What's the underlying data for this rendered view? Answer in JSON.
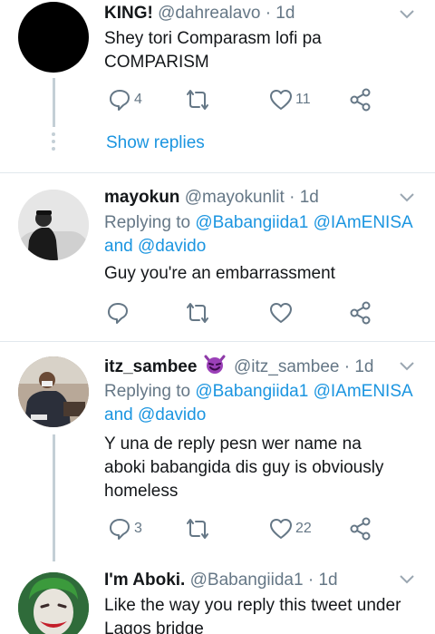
{
  "tweets": [
    {
      "name": "KING!",
      "handle": "@dahrealavo",
      "time": "· 1d",
      "text": "Shey  tori Comparasm lofi pa COMPARISM",
      "reply_count": "4",
      "retweet_count": "",
      "like_count": "11",
      "show_replies": "Show replies"
    },
    {
      "name": "mayokun",
      "handle": "@mayokunlit",
      "time": "· 1d",
      "replying_prefix": "Replying to",
      "mentions": [
        "@Babangiida1",
        "@IAmENISA"
      ],
      "and_word": "and",
      "mention_last": "@davido",
      "text": "Guy you're an embarrassment"
    },
    {
      "name": "itz_sambee",
      "emoji": "smiling-devil-emoji",
      "handle": "@itz_sambee",
      "time": "· 1d",
      "replying_prefix": "Replying to",
      "mentions": [
        "@Babangiida1",
        "@IAmENISA"
      ],
      "and_word": "and",
      "mention_last": "@davido",
      "text": "Y una de reply pesn wer name na aboki babangida dis guy is obviously homeless",
      "reply_count": "3",
      "like_count": "22"
    },
    {
      "name": "I'm Aboki.",
      "handle": "@Babangiida1",
      "time": "· 1d",
      "text": "Like the way you reply this tweet under Lagos bridge"
    }
  ],
  "colors": {
    "accent": "#1b95e0",
    "muted": "#657786",
    "divider": "#e1e8ed"
  }
}
